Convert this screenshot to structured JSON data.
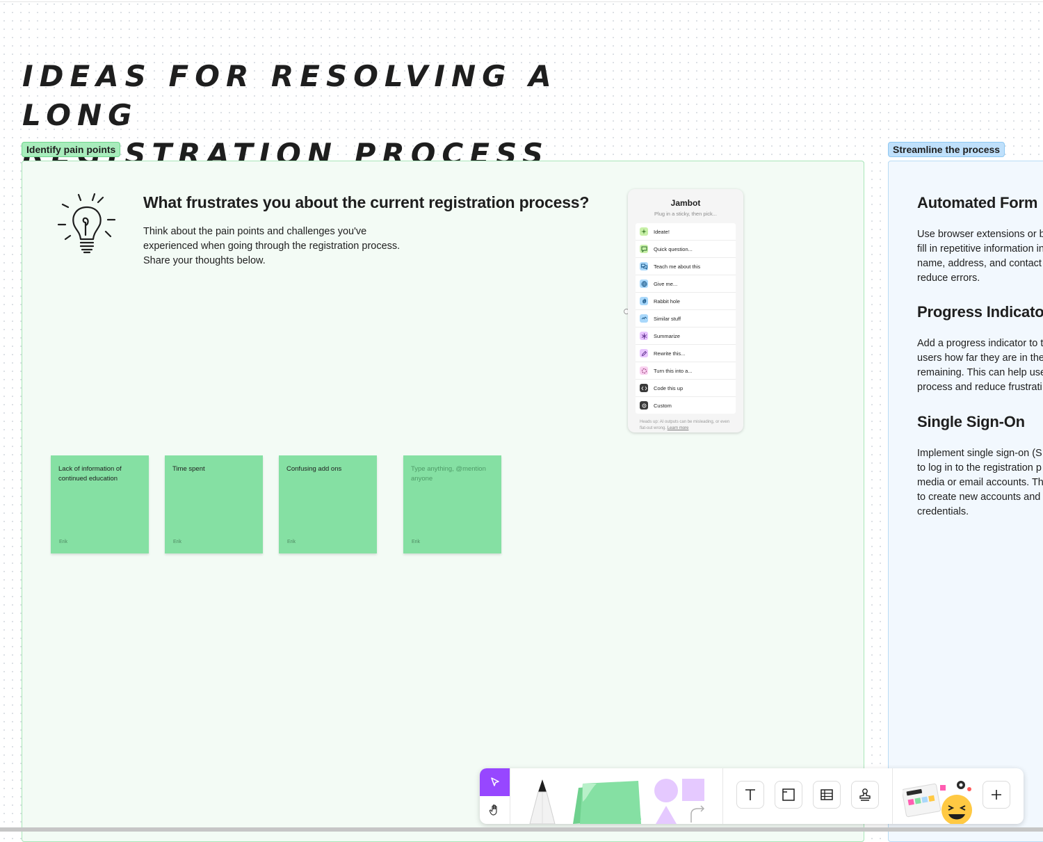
{
  "board": {
    "title_line1": "Ideas for resolving a long",
    "title_line2": "registration process"
  },
  "sections": {
    "left_tag": "Identify pain points",
    "right_tag": "Streamline the process"
  },
  "prompt": {
    "question": "What frustrates you about the current registration process?",
    "body_lines": [
      "Think about the pain points and challenges you've",
      "experienced when going through the registration process.",
      "Share your thoughts below."
    ]
  },
  "jambot": {
    "title": "Jambot",
    "subtitle": "Plug in a sticky, then pick...",
    "items": [
      {
        "label": "Ideate!",
        "icon": "sparkle-icon",
        "color": "#c8f0a8"
      },
      {
        "label": "Quick question...",
        "icon": "chat-bubble-icon",
        "color": "#c8f0a8"
      },
      {
        "label": "Teach me about this",
        "icon": "chat-bubbles-icon",
        "color": "#a9d8fb"
      },
      {
        "label": "Give me...",
        "icon": "globe-icon",
        "color": "#a9d8fb"
      },
      {
        "label": "Rabbit hole",
        "icon": "spiral-icon",
        "color": "#a9d8fb"
      },
      {
        "label": "Similar stuff",
        "icon": "link-icon",
        "color": "#a9d8fb"
      },
      {
        "label": "Summarize",
        "icon": "asterisk-icon",
        "color": "#e8c4ff"
      },
      {
        "label": "Rewrite this...",
        "icon": "pencil-icon",
        "color": "#e8c4ff"
      },
      {
        "label": "Turn this into a...",
        "icon": "refresh-icon",
        "color": "#f9d0f0"
      },
      {
        "label": "Code this up",
        "icon": "code-icon",
        "color": "#3a3a3a"
      },
      {
        "label": "Custom",
        "icon": "custom-icon",
        "color": "#3a3a3a"
      }
    ],
    "footer": "Heads up: AI outputs can be misleading, or even flat-out wrong.",
    "footer_link": "Learn more"
  },
  "stickies": [
    {
      "text": "Lack of information of continued education",
      "author": "Erik",
      "placeholder": false
    },
    {
      "text": "Time spent",
      "author": "Erik",
      "placeholder": false
    },
    {
      "text": "Confusing add ons",
      "author": "Erik",
      "placeholder": false
    },
    {
      "text": "Type anything, @mention anyone",
      "author": "Erik",
      "placeholder": true
    }
  ],
  "right_content": {
    "items": [
      {
        "title": "Automated Form",
        "lines": [
          "Use browser extensions or b",
          "fill in repetitive information in",
          "name, address, and contact",
          "reduce errors."
        ]
      },
      {
        "title": "Progress Indicato",
        "lines": [
          "Add a progress indicator to t",
          "users how far they are in the",
          "remaining. This can help use",
          "process and reduce frustrati"
        ]
      },
      {
        "title": "Single Sign-On",
        "lines": [
          "Implement single sign-on (S",
          "to log in to the registration p",
          "media or email accounts. Th",
          "to create new accounts and",
          "credentials."
        ]
      }
    ]
  },
  "toolbar": {
    "tools": [
      "select-tool",
      "hand-tool",
      "pen-tool",
      "sticky-note-tool",
      "shapes-tool",
      "text-tool",
      "section-tool",
      "table-tool",
      "stamp-tool",
      "widgets-tool",
      "more-tool"
    ],
    "accent": "#9747ff"
  },
  "colors": {
    "sticky_green": "#85e0a3",
    "section_green_bg": "#f3fbf5",
    "section_blue_bg": "#f2f8fe"
  }
}
